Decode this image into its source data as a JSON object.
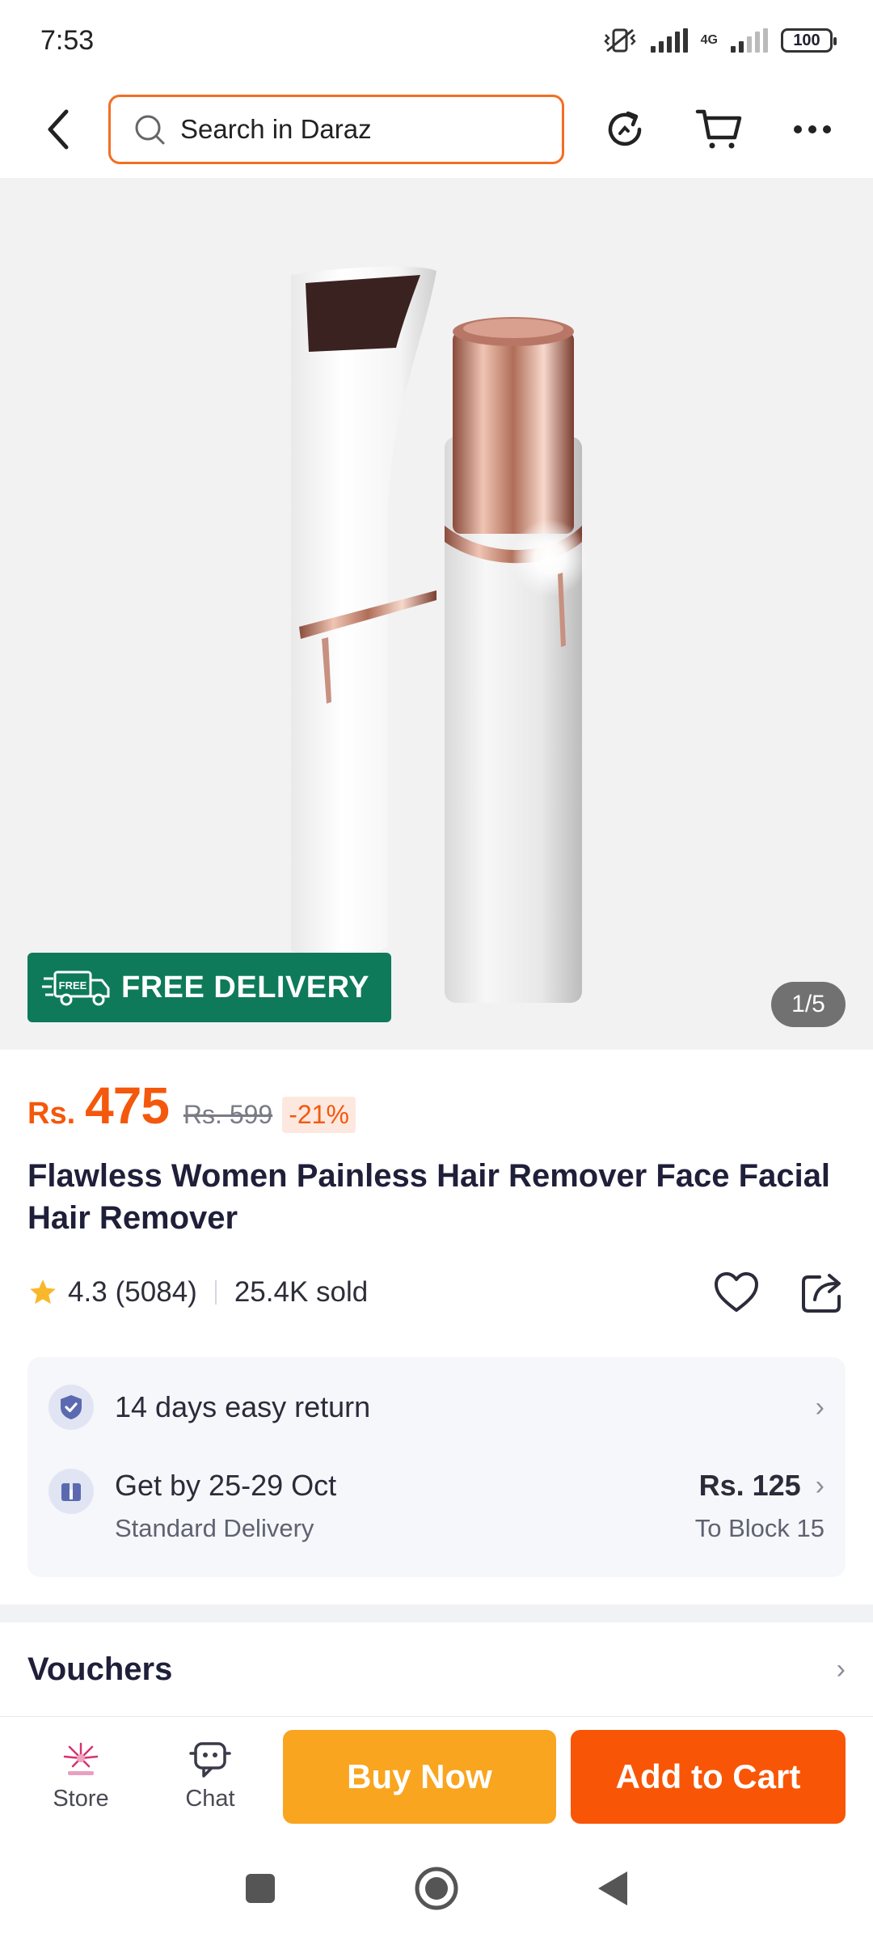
{
  "status_bar": {
    "time": "7:53",
    "network": "4G",
    "battery": "100"
  },
  "header": {
    "search_placeholder": "Search in Daraz"
  },
  "gallery": {
    "badge_text": "FREE DELIVERY",
    "badge_icon_text": "FREE",
    "page_indicator": "1/5"
  },
  "product": {
    "currency": "Rs.",
    "price": "475",
    "old_price": "Rs. 599",
    "discount": "-21%",
    "title": "Flawless Women Painless Hair Remover Face Facial Hair Remover",
    "rating": "4.3",
    "reviews": "(5084)",
    "sold": "25.4K sold"
  },
  "info": {
    "return_text": "14 days easy return",
    "delivery_date": "Get by 25-29 Oct",
    "delivery_type": "Standard Delivery",
    "delivery_fee": "Rs. 125",
    "delivery_location": "To Block 15"
  },
  "vouchers": {
    "title": "Vouchers"
  },
  "bottom_bar": {
    "store_label": "Store",
    "chat_label": "Chat",
    "buy_now_label": "Buy Now",
    "add_to_cart_label": "Add to Cart"
  },
  "colors": {
    "accent": "#f85606",
    "buy_now": "#f9a51f",
    "free_delivery": "#0e7a5a"
  }
}
